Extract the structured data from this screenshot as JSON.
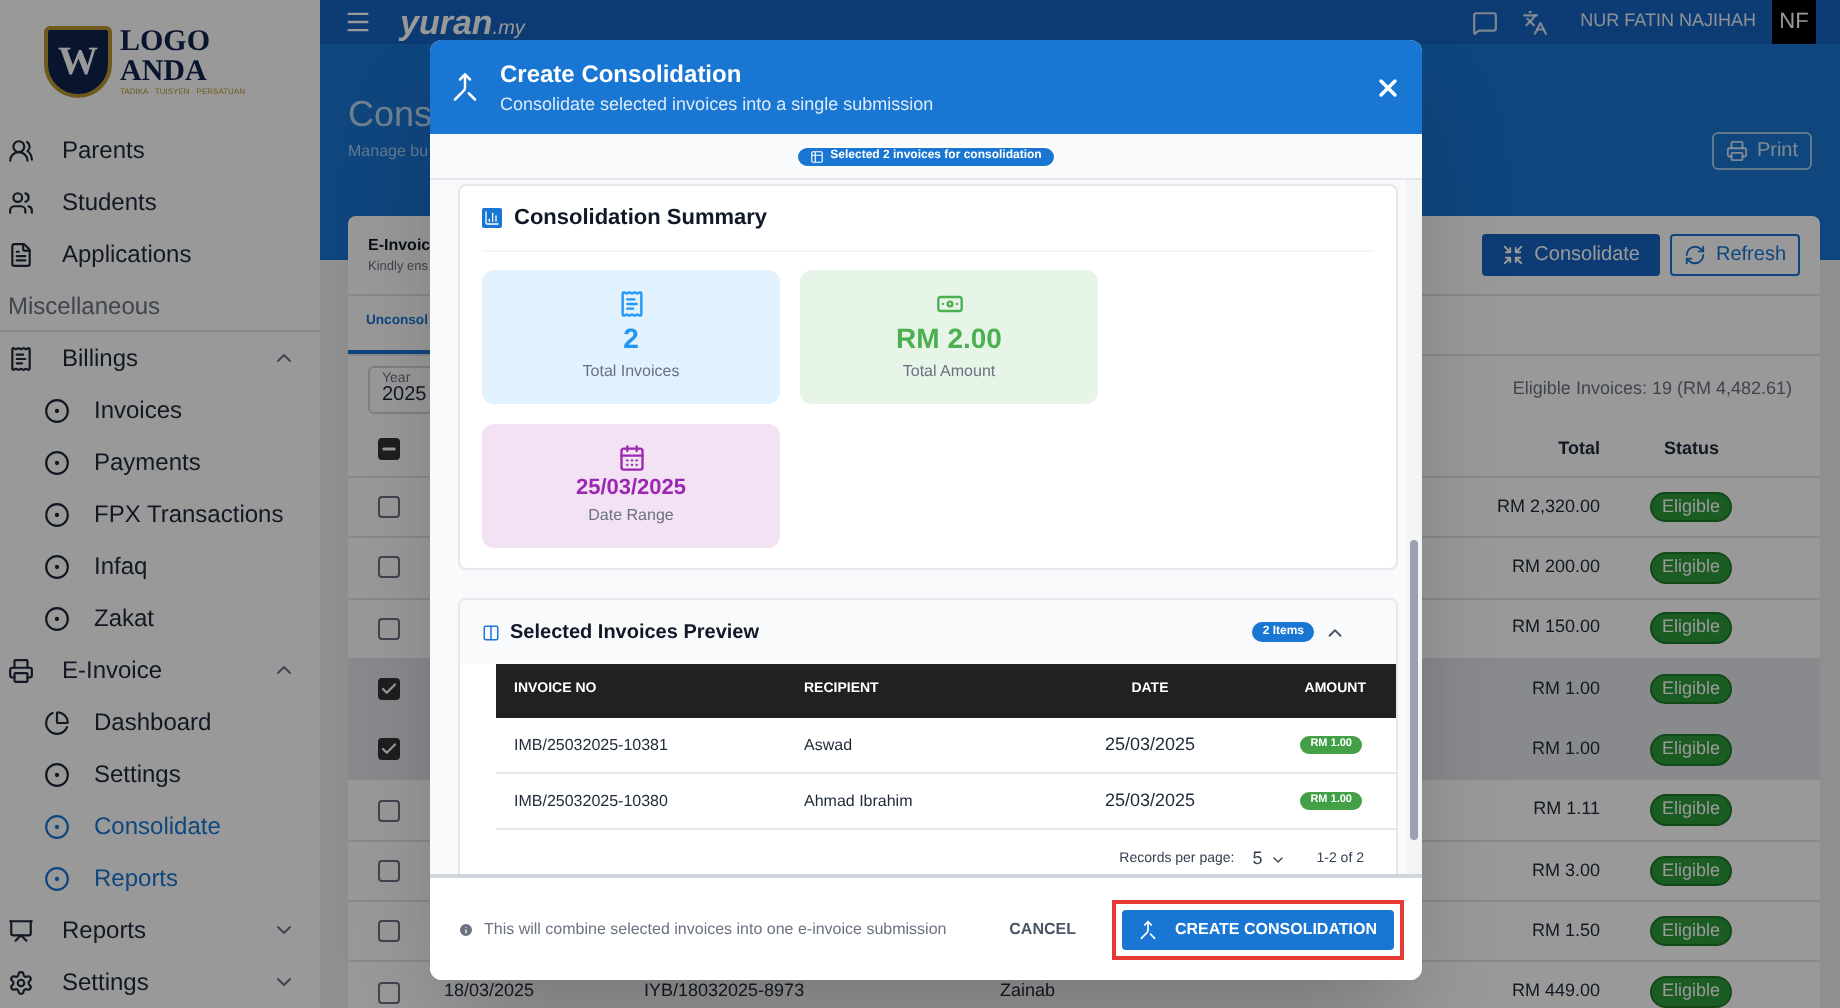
{
  "header": {
    "logo_main": "yuran",
    "logo_suffix": ".my",
    "user_name": "NUR FATIN NAJIHAH",
    "avatar": "NF"
  },
  "sidebar": {
    "logo": {
      "letter": "W",
      "line1": "LOGO",
      "line2": "ANDA",
      "tagline": "TADIKA · TUISYEN · PERSATUAN"
    },
    "items": [
      {
        "kind": "link",
        "label": "Parents"
      },
      {
        "kind": "link",
        "label": "Students"
      },
      {
        "kind": "link",
        "label": "Applications"
      },
      {
        "kind": "section",
        "label": "Miscellaneous"
      },
      {
        "kind": "group",
        "label": "Billings",
        "expanded": true,
        "children": [
          {
            "label": "Invoices",
            "selected": false
          },
          {
            "label": "Payments",
            "selected": false
          },
          {
            "label": "FPX Transactions",
            "selected": false
          },
          {
            "label": "Infaq",
            "selected": false
          },
          {
            "label": "Zakat",
            "selected": false
          }
        ]
      },
      {
        "kind": "group",
        "label": "E-Invoice",
        "expanded": true,
        "children": [
          {
            "label": "Dashboard",
            "selected": false
          },
          {
            "label": "Settings",
            "selected": false
          },
          {
            "label": "Consolidate",
            "selected": true
          },
          {
            "label": "Reports",
            "selected": true
          }
        ]
      },
      {
        "kind": "group",
        "label": "Reports",
        "expanded": false
      },
      {
        "kind": "group",
        "label": "Settings",
        "expanded": false
      }
    ]
  },
  "page": {
    "title": "Cons",
    "subtitle": "Manage bu",
    "print_button": "Print"
  },
  "card": {
    "title": "E-Invoic",
    "subtitle": "Kindly ens",
    "buttons": [
      "Consolidate",
      "Refresh"
    ],
    "tabs": [
      {
        "label": "Unconsol",
        "selected": true
      }
    ],
    "year": {
      "label": "Year",
      "value": "2025"
    },
    "eligible": "Eligible Invoices: 19 (RM 4,482.61)",
    "table": {
      "select_all_indeterminate": true,
      "columns": [
        "Total",
        "Status"
      ],
      "rows": [
        {
          "checked": false,
          "total": "RM 2,320.00",
          "status": "Eligible"
        },
        {
          "checked": false,
          "total": "RM 200.00",
          "status": "Eligible"
        },
        {
          "checked": false,
          "total": "RM 150.00",
          "status": "Eligible"
        },
        {
          "checked": true,
          "total": "RM 1.00",
          "status": "Eligible"
        },
        {
          "checked": true,
          "total": "RM 1.00",
          "status": "Eligible"
        },
        {
          "checked": false,
          "total": "RM 1.11",
          "status": "Eligible"
        },
        {
          "checked": false,
          "total": "RM 3.00",
          "status": "Eligible"
        },
        {
          "checked": false,
          "total": "RM 1.50",
          "status": "Eligible"
        },
        {
          "checked": false,
          "date": "18/03/2025",
          "invoice_no": "IYB/18032025-8973",
          "recipient": "Zainab",
          "total": "RM 449.00",
          "status": "Eligible"
        }
      ]
    }
  },
  "modal": {
    "title": "Create Consolidation",
    "subtitle": "Consolidate selected invoices into a single submission",
    "badge": "Selected 2 invoices for consolidation",
    "summary": {
      "title": "Consolidation Summary",
      "stats": [
        {
          "value": "2",
          "label": "Total Invoices",
          "color": "#2196f3"
        },
        {
          "value": "RM 2.00",
          "label": "Total Amount",
          "color": "#4caf50"
        },
        {
          "value": "25/03/2025",
          "label": "Date Range",
          "color": "#9c27b0"
        }
      ]
    },
    "preview": {
      "title": "Selected Invoices Preview",
      "count": "2 Items",
      "expanded": true,
      "columns": [
        "INVOICE NO",
        "RECIPIENT",
        "DATE",
        "AMOUNT"
      ],
      "rows": [
        {
          "invoice_no": "IMB/25032025-10381",
          "recipient": "Aswad",
          "date": "25/03/2025",
          "amount": "RM 1.00"
        },
        {
          "invoice_no": "IMB/25032025-10380",
          "recipient": "Ahmad Ibrahim",
          "date": "25/03/2025",
          "amount": "RM 1.00"
        }
      ],
      "records_label": "Records per page:",
      "per_page": "5",
      "range": "1-2 of 2"
    },
    "footer": {
      "note": "This will combine selected invoices into one e-invoice submission",
      "cancel": "CANCEL",
      "submit": "CREATE CONSOLIDATION"
    }
  }
}
